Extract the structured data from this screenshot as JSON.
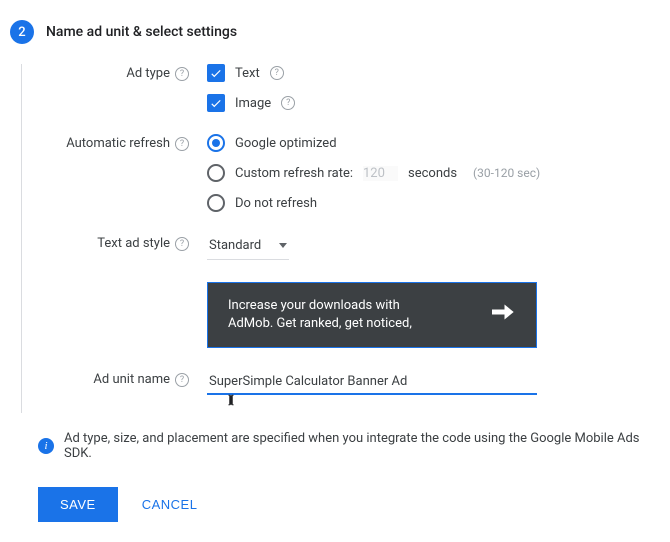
{
  "step_number": "2",
  "section_title": "Name ad unit & select settings",
  "ad_type": {
    "label": "Ad type",
    "text_label": "Text",
    "text_checked": true,
    "image_label": "Image",
    "image_checked": true
  },
  "auto_refresh": {
    "label": "Automatic refresh",
    "options": {
      "google": "Google optimized",
      "custom_prefix": "Custom refresh rate:",
      "custom_value": "120",
      "custom_unit": "seconds",
      "custom_hint": "(30-120 sec)",
      "none": "Do not refresh"
    },
    "selected": "google"
  },
  "text_ad_style": {
    "label": "Text ad style",
    "value": "Standard"
  },
  "promo": {
    "line1": "Increase your downloads with",
    "line2": "AdMob. Get ranked, get noticed,"
  },
  "ad_unit_name": {
    "label": "Ad unit name",
    "value": "SuperSimple Calculator Banner Ad"
  },
  "info_text": "Ad type, size, and placement are specified when you integrate the code using the Google Mobile Ads SDK.",
  "buttons": {
    "save": "SAVE",
    "cancel": "CANCEL"
  }
}
